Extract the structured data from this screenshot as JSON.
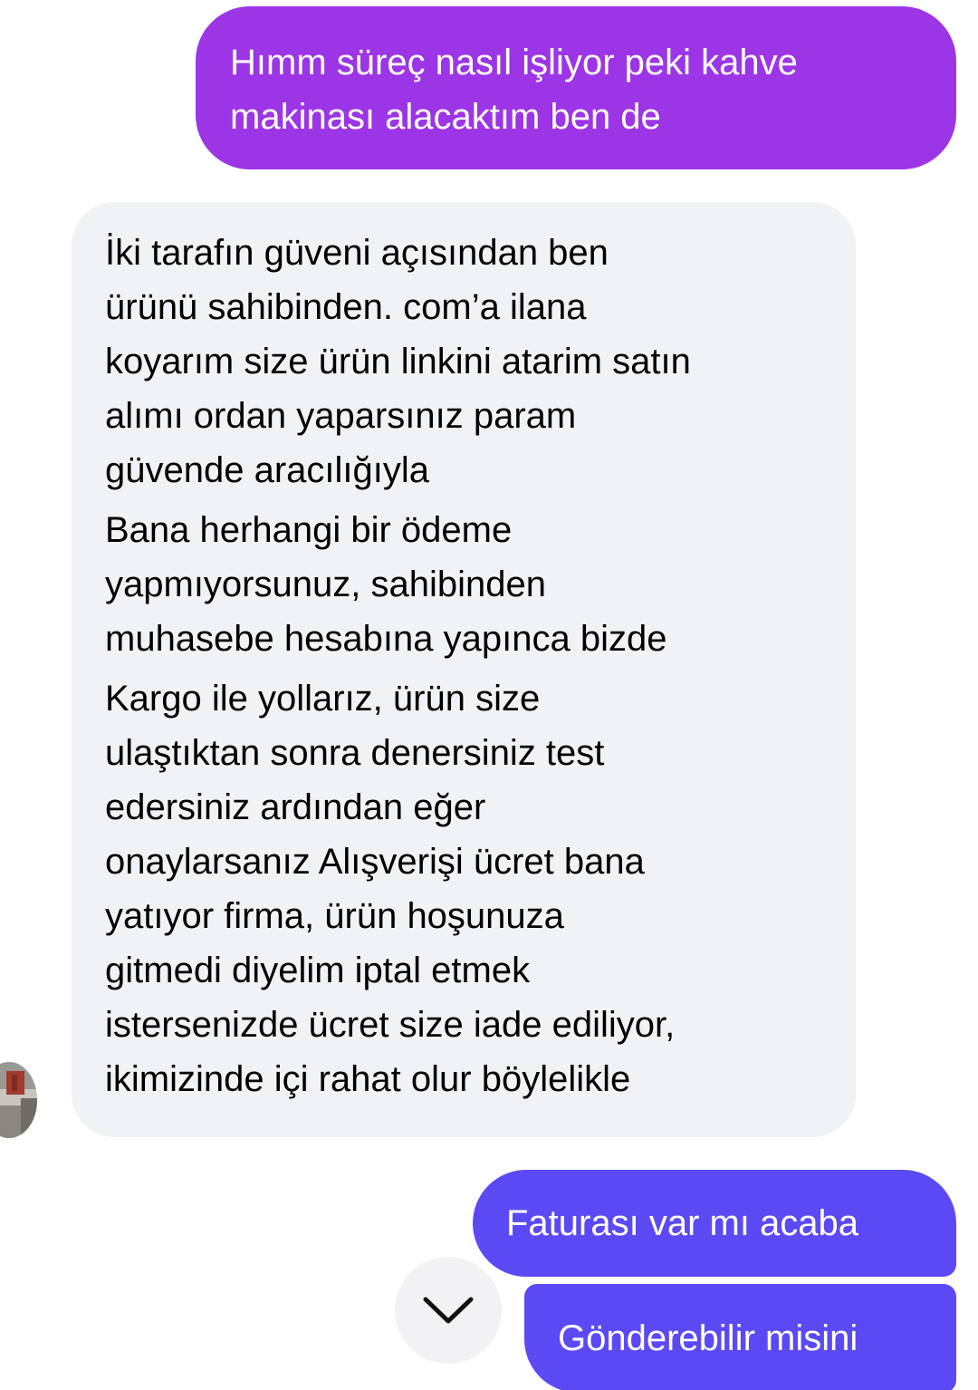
{
  "messages": {
    "outgoing_1": {
      "lines": [
        "Hımm süreç nasıl işliyor peki kahve",
        "makinası alacaktım ben de"
      ],
      "color": "#9c35e6"
    },
    "incoming_1": {
      "paragraphs": [
        [
          "İki tarafın güveni açısından ben",
          "ürünü sahibinden. com’a ilana",
          "koyarım size ürün linkini atarim satın",
          "alımı ordan yaparsınız param",
          "güvende aracılığıyla"
        ],
        [
          "Bana herhangi bir ödeme",
          "yapmıyorsunuz, sahibinden",
          "muhasebe hesabına yapınca bizde"
        ],
        [
          "Kargo ile yollarız, ürün size",
          "ulaştıktan sonra denersiniz test",
          "edersiniz ardından eğer",
          "onaylarsanız Alışverişi ücret bana",
          "yatıyor firma, ürün hoşunuza",
          "gitmedi diyelim iptal etmek",
          "istersenizde ücret size iade ediliyor,",
          "ikimizinde içi rahat olur böylelikle"
        ]
      ],
      "color": "#f1f2f5"
    },
    "outgoing_2": {
      "text": "Faturası var mı acaba",
      "color": "#5b4af4"
    },
    "outgoing_3": {
      "text": "Gönderebilir misini",
      "color": "#5b4af4"
    }
  },
  "icons": {
    "scroll_down": "chevron-down-icon",
    "sender_avatar": "avatar"
  }
}
